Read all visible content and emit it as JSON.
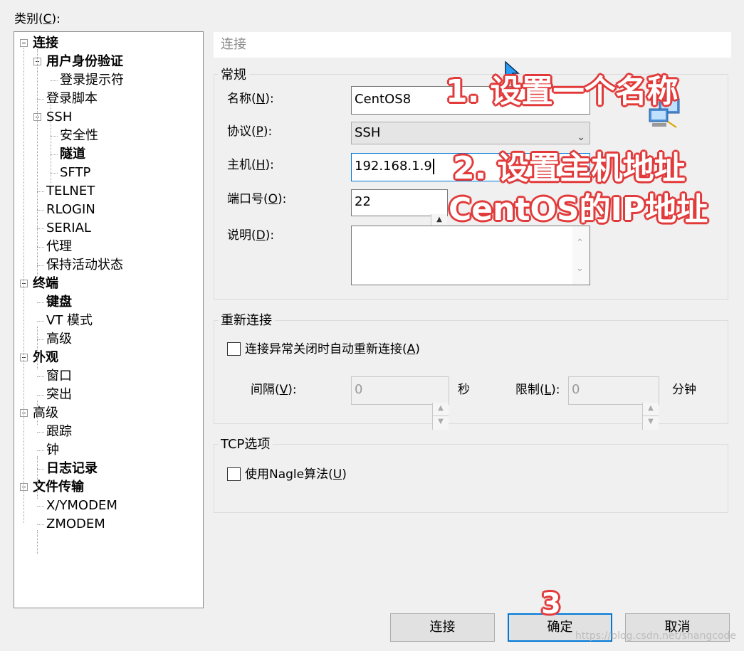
{
  "category": {
    "label_prefix": "类别(",
    "label_key": "C",
    "label_suffix": "):",
    "tree": [
      {
        "label": "连接",
        "bold": true
      },
      {
        "label": "用户身份验证",
        "bold": true
      },
      {
        "label": "登录提示符",
        "bold": false
      },
      {
        "label": "登录脚本",
        "bold": false
      },
      {
        "label": "SSH",
        "bold": false
      },
      {
        "label": "安全性",
        "bold": false
      },
      {
        "label": "隧道",
        "bold": true
      },
      {
        "label": "SFTP",
        "bold": false
      },
      {
        "label": "TELNET",
        "bold": false
      },
      {
        "label": "RLOGIN",
        "bold": false
      },
      {
        "label": "SERIAL",
        "bold": false
      },
      {
        "label": "代理",
        "bold": false
      },
      {
        "label": "保持活动状态",
        "bold": false
      },
      {
        "label": "终端",
        "bold": true
      },
      {
        "label": "键盘",
        "bold": true
      },
      {
        "label": "VT 模式",
        "bold": false
      },
      {
        "label": "高级",
        "bold": false
      },
      {
        "label": "外观",
        "bold": true
      },
      {
        "label": "窗口",
        "bold": false
      },
      {
        "label": "突出",
        "bold": false
      },
      {
        "label": "高级",
        "bold": false
      },
      {
        "label": "跟踪",
        "bold": false
      },
      {
        "label": "钟",
        "bold": false
      },
      {
        "label": "日志记录",
        "bold": true
      },
      {
        "label": "文件传输",
        "bold": true
      },
      {
        "label": "X/YMODEM",
        "bold": false
      },
      {
        "label": "ZMODEM",
        "bold": false
      }
    ]
  },
  "page": {
    "header": "连接",
    "general": {
      "title": "常规",
      "name_label": {
        "pre": "名称(",
        "key": "N",
        "post": "):"
      },
      "name_value": "CentOS8",
      "protocol_label": {
        "pre": "协议(",
        "key": "P",
        "post": "):"
      },
      "protocol_value": "SSH",
      "host_label": {
        "pre": "主机(",
        "key": "H",
        "post": "):"
      },
      "host_value": "192.168.1.9",
      "port_label": {
        "pre": "端口号(",
        "key": "O",
        "post": "):"
      },
      "port_value": "22",
      "desc_label": {
        "pre": "说明(",
        "key": "D",
        "post": "):"
      },
      "desc_value": ""
    },
    "reconnect": {
      "title": "重新连接",
      "checkbox_label": {
        "pre": "连接异常关闭时自动重新连接(",
        "key": "A",
        "post": ")"
      },
      "interval_label": {
        "pre": "间隔(",
        "key": "V",
        "post": "):"
      },
      "interval_value": "0",
      "interval_unit": "秒",
      "limit_label": {
        "pre": "限制(",
        "key": "L",
        "post": "):"
      },
      "limit_value": "0",
      "limit_unit": "分钟"
    },
    "tcp": {
      "title": "TCP选项",
      "nagle_label": {
        "pre": "使用Nagle算法(",
        "key": "U",
        "post": ")"
      }
    }
  },
  "buttons": {
    "connect": "连接",
    "ok": "确定",
    "cancel": "取消"
  },
  "annotations": {
    "step1": "1. 设置一个名称",
    "step2": "2. 设置主机地址",
    "step2b": "CentOS的IP地址",
    "step3": "3"
  },
  "watermark": "https://blog.csdn.net/shangcode",
  "colors": {
    "accent": "#0078d7",
    "annotation": "#e23a3a"
  }
}
